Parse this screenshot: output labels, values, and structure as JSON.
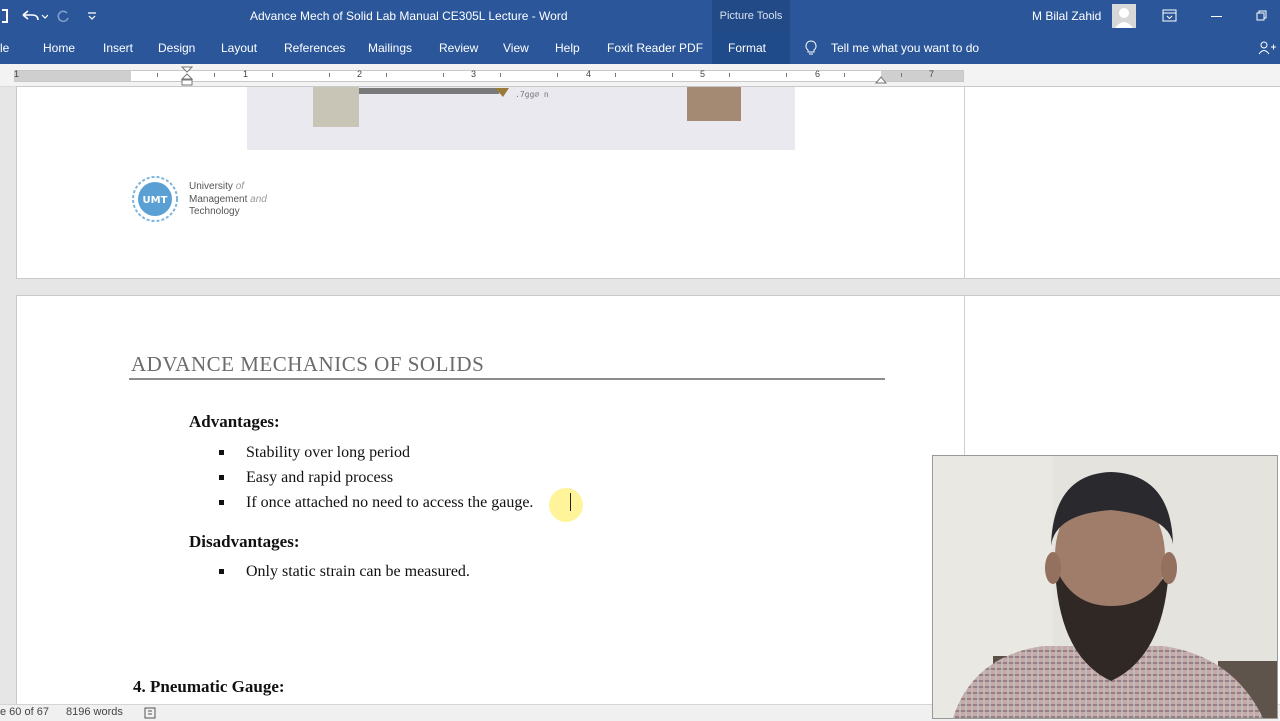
{
  "titlebar": {
    "doc_title": "Advance Mech of Solid Lab Manual CE305L Lecture  -  Word",
    "user": "M Bilal Zahid",
    "picture_tools": "Picture Tools"
  },
  "ribbon": {
    "tabs": [
      "le",
      "Home",
      "Insert",
      "Design",
      "Layout",
      "References",
      "Mailings",
      "Review",
      "View",
      "Help",
      "Foxit Reader PDF",
      "Format"
    ],
    "tell_me": "Tell me what you want to do"
  },
  "ruler": {
    "numbers": [
      "1",
      "1",
      "2",
      "3",
      "4",
      "5",
      "6",
      "7"
    ]
  },
  "logo": {
    "line1": "University",
    "line1b": "of",
    "line2": "Management",
    "line2b": "and",
    "line3": "Technology",
    "badge": "UMT"
  },
  "document": {
    "header": "ADVANCE MECHANICS OF SOLIDS",
    "advantages_heading": "Advantages:",
    "advantages": [
      "Stability over long period",
      "Easy and rapid process",
      "If once attached no need to access the gauge."
    ],
    "disadvantages_heading": "Disadvantages:",
    "disadvantages": [
      "Only static strain can be measured."
    ],
    "next_heading": "4.   Pneumatic Gauge:"
  },
  "status": {
    "page": "e 60 of 67",
    "words": "8196 words"
  }
}
